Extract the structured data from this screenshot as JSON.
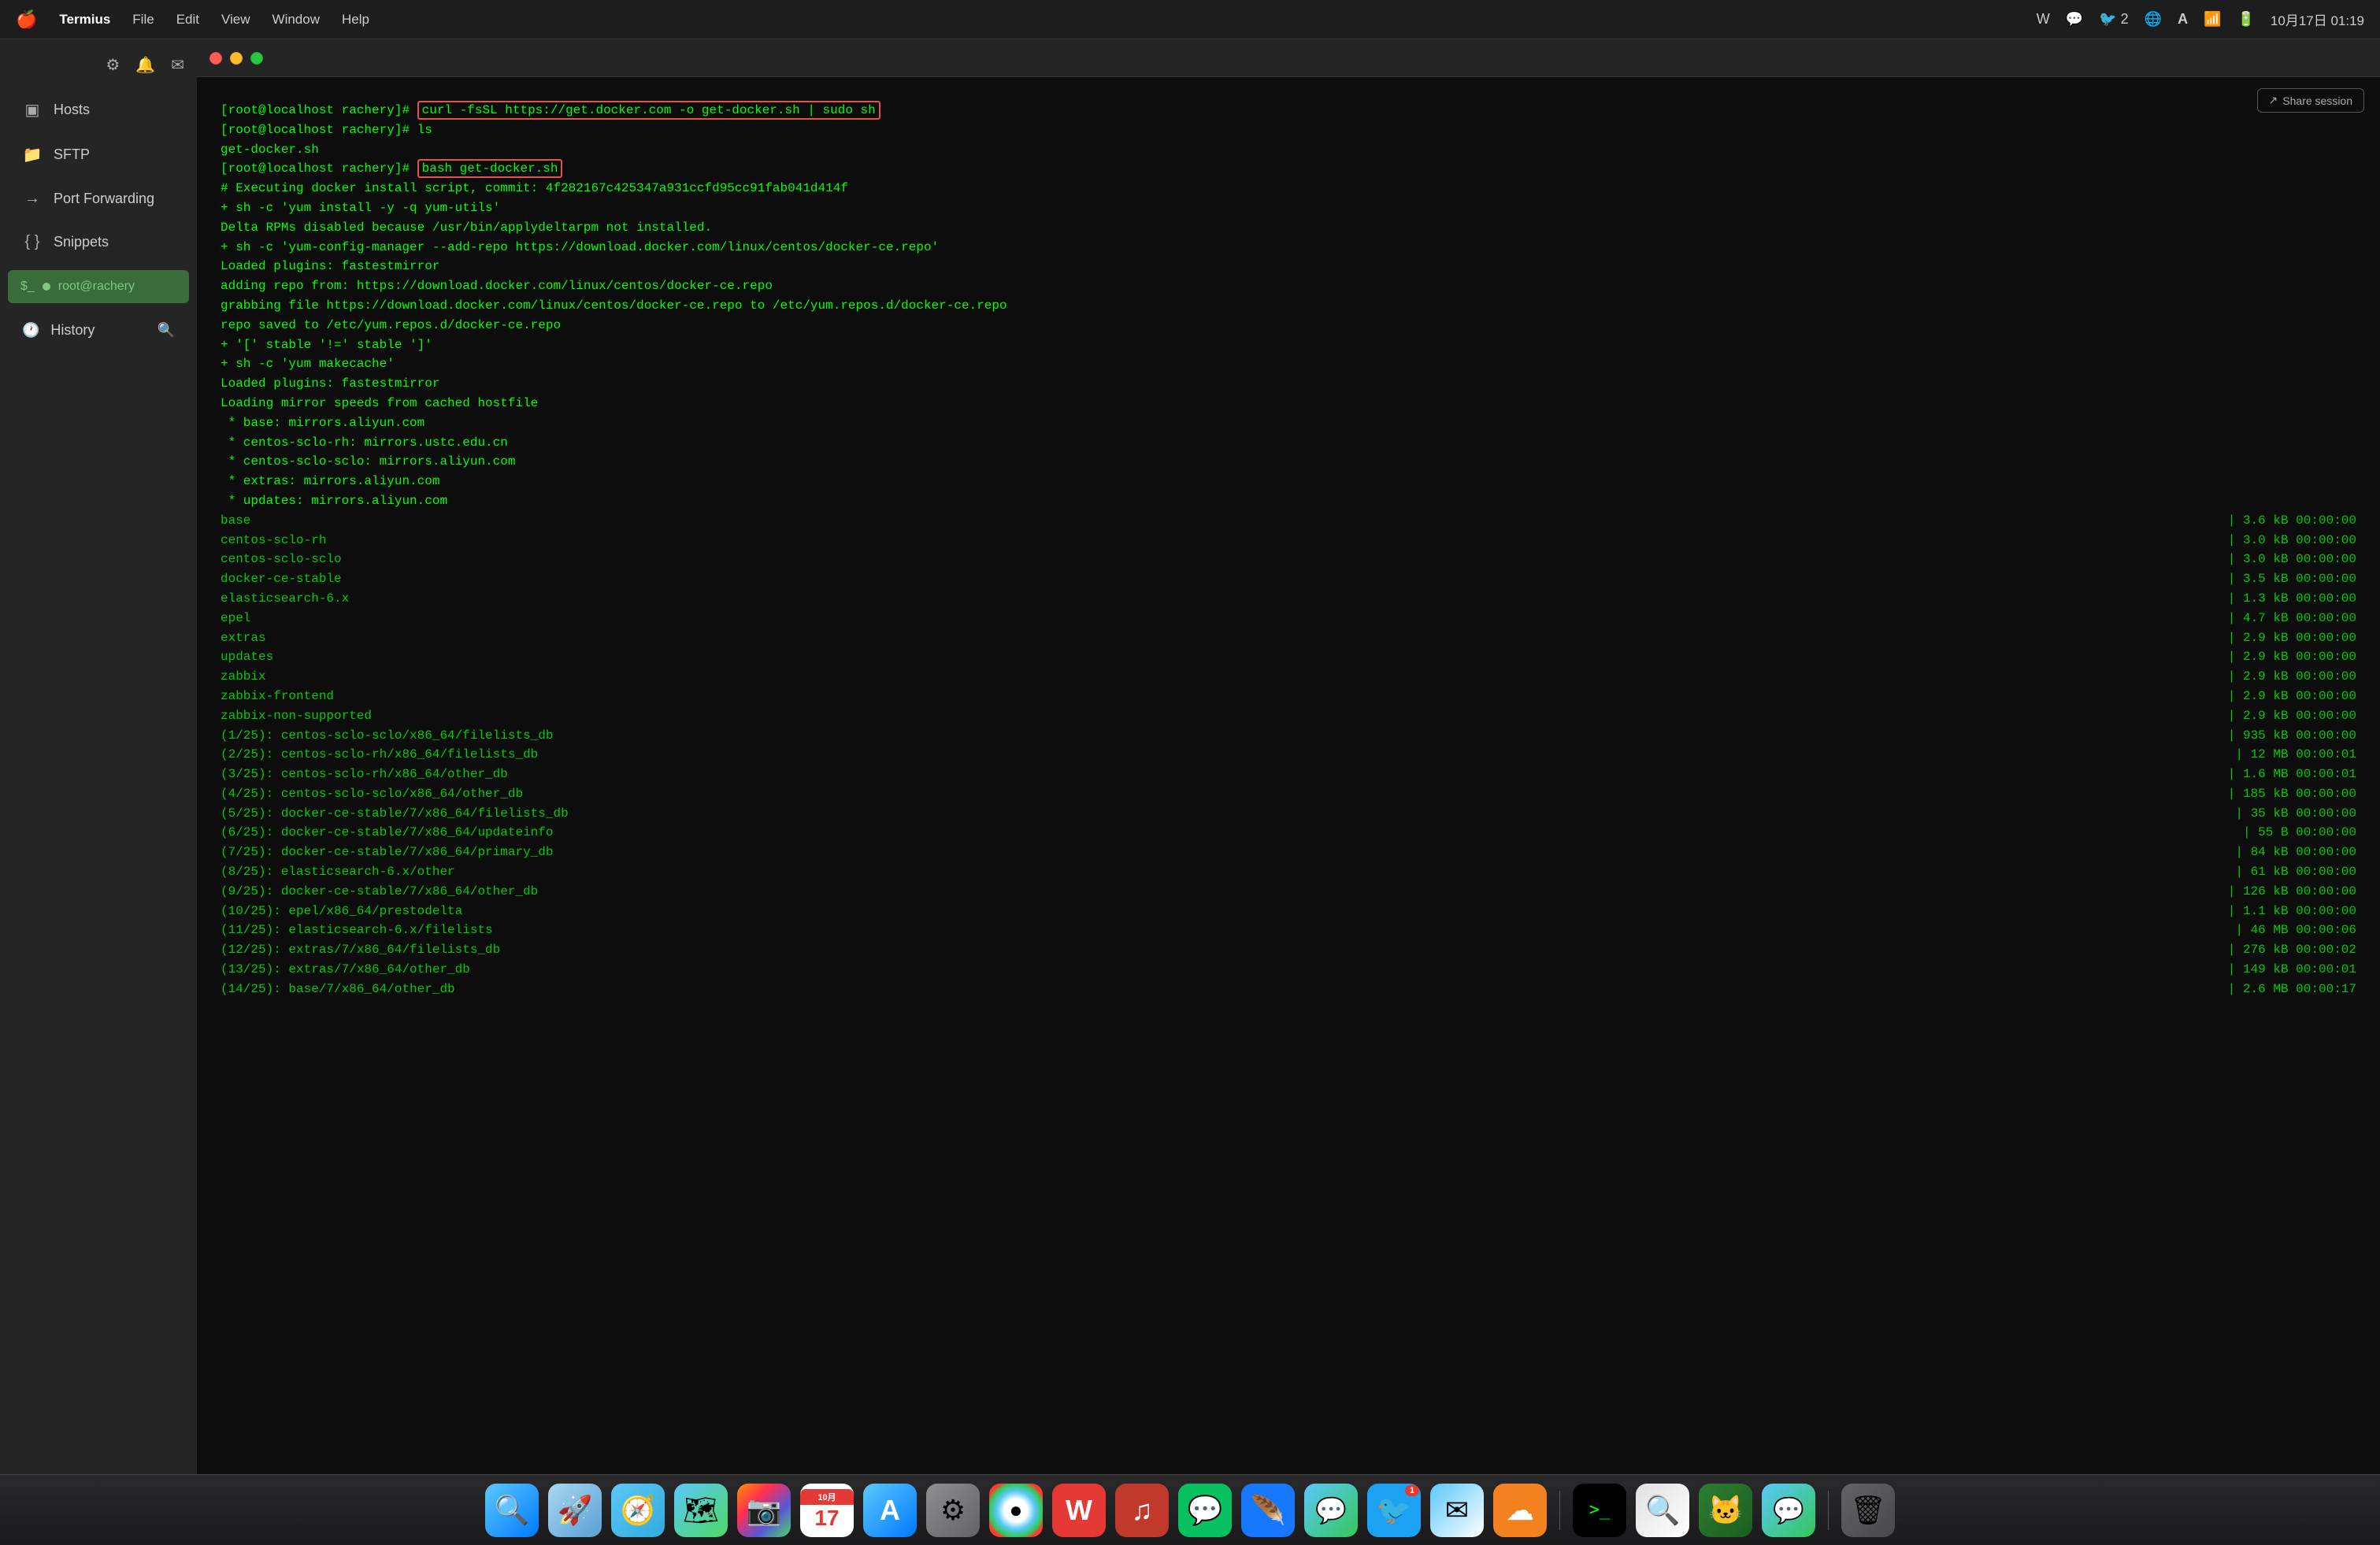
{
  "menubar": {
    "apple": "🍎",
    "app": "Termius",
    "items": [
      "File",
      "Edit",
      "View",
      "Window",
      "Help"
    ]
  },
  "menubar_right": {
    "items": [
      "W",
      "💬",
      "🐦",
      "🌐",
      "A",
      "📶",
      "🔋",
      "10月17日",
      "01:19"
    ]
  },
  "sidebar": {
    "settings_icon": "⚙",
    "bell_icon": "🔔",
    "mail_icon": "✉",
    "hosts_label": "Hosts",
    "sftp_label": "SFTP",
    "port_forwarding_label": "Port Forwarding",
    "snippets_label": "Snippets",
    "active_session_label": "root@rachery",
    "history_label": "History"
  },
  "terminal": {
    "share_session_label": "Share session",
    "lines": [
      {
        "type": "prompt",
        "text": "[root@localhost rachery]#",
        "cmd": "curl -fsSL https://get.docker.com -o get-docker.sh | sudo sh",
        "highlight": true
      },
      {
        "type": "prompt",
        "text": "[root@localhost rachery]#",
        "cmd": "ls",
        "highlight": false
      },
      {
        "type": "normal",
        "text": "get-docker.sh"
      },
      {
        "type": "prompt",
        "text": "[root@localhost rachery]#",
        "cmd": "bash get-docker.sh",
        "highlight": true
      },
      {
        "type": "normal",
        "text": "# Executing docker install script, commit: 4f282167c425347a931ccfd95cc91fab041d414f"
      },
      {
        "type": "normal",
        "text": "+ sh -c 'yum install -y -q yum-utils'"
      },
      {
        "type": "normal",
        "text": "Delta RPMs disabled because /usr/bin/applydeltarpm not installed."
      },
      {
        "type": "normal",
        "text": "+ sh -c 'yum-config-manager --add-repo https://download.docker.com/linux/centos/docker-ce.repo'"
      },
      {
        "type": "normal",
        "text": "Loaded plugins: fastestmirror"
      },
      {
        "type": "normal",
        "text": "adding repo from: https://download.docker.com/linux/centos/docker-ce.repo"
      },
      {
        "type": "normal",
        "text": "grabbing file https://download.docker.com/linux/centos/docker-ce.repo to /etc/yum.repos.d/docker-ce.repo"
      },
      {
        "type": "normal",
        "text": "repo saved to /etc/yum.repos.d/docker-ce.repo"
      },
      {
        "type": "normal",
        "text": "+ '[' stable '!=' stable ']'"
      },
      {
        "type": "normal",
        "text": "+ sh -c 'yum makecache'"
      },
      {
        "type": "normal",
        "text": "Loaded plugins: fastestmirror"
      },
      {
        "type": "normal",
        "text": "Loading mirror speeds from cached hostfile"
      },
      {
        "type": "normal",
        "text": " * base: mirrors.aliyun.com"
      },
      {
        "type": "normal",
        "text": " * centos-sclo-rh: mirrors.ustc.edu.cn"
      },
      {
        "type": "normal",
        "text": " * centos-sclo-sclo: mirrors.aliyun.com"
      },
      {
        "type": "normal",
        "text": " * extras: mirrors.aliyun.com"
      },
      {
        "type": "normal",
        "text": " * updates: mirrors.aliyun.com"
      },
      {
        "type": "table",
        "left": "base",
        "right": "| 3.6 kB   00:00:00"
      },
      {
        "type": "table",
        "left": "centos-sclo-rh",
        "right": "| 3.0 kB   00:00:00"
      },
      {
        "type": "table",
        "left": "centos-sclo-sclo",
        "right": "| 3.0 kB   00:00:00"
      },
      {
        "type": "table",
        "left": "docker-ce-stable",
        "right": "| 3.5 kB   00:00:00"
      },
      {
        "type": "table",
        "left": "elasticsearch-6.x",
        "right": "| 1.3 kB   00:00:00"
      },
      {
        "type": "table",
        "left": "epel",
        "right": "| 4.7 kB   00:00:00"
      },
      {
        "type": "table",
        "left": "extras",
        "right": "| 2.9 kB   00:00:00"
      },
      {
        "type": "table",
        "left": "updates",
        "right": "| 2.9 kB   00:00:00"
      },
      {
        "type": "table",
        "left": "zabbix",
        "right": "| 2.9 kB   00:00:00"
      },
      {
        "type": "table",
        "left": "zabbix-frontend",
        "right": "| 2.9 kB   00:00:00"
      },
      {
        "type": "table",
        "left": "zabbix-non-supported",
        "right": "| 2.9 kB   00:00:00"
      },
      {
        "type": "table",
        "left": "(1/25): centos-sclo-sclo/x86_64/filelists_db",
        "right": "| 935 kB   00:00:00"
      },
      {
        "type": "table",
        "left": "(2/25): centos-sclo-rh/x86_64/filelists_db",
        "right": "|  12 MB   00:00:01"
      },
      {
        "type": "table",
        "left": "(3/25): centos-sclo-rh/x86_64/other_db",
        "right": "| 1.6 MB   00:00:01"
      },
      {
        "type": "table",
        "left": "(4/25): centos-sclo-sclo/x86_64/other_db",
        "right": "| 185 kB   00:00:00"
      },
      {
        "type": "table",
        "left": "(5/25): docker-ce-stable/7/x86_64/filelists_db",
        "right": "|  35 kB   00:00:00"
      },
      {
        "type": "table",
        "left": "(6/25): docker-ce-stable/7/x86_64/updateinfo",
        "right": "|   55 B   00:00:00"
      },
      {
        "type": "table",
        "left": "(7/25): docker-ce-stable/7/x86_64/primary_db",
        "right": "|  84 kB   00:00:00"
      },
      {
        "type": "table",
        "left": "(8/25): elasticsearch-6.x/other",
        "right": "|  61 kB   00:00:00"
      },
      {
        "type": "table",
        "left": "(9/25): docker-ce-stable/7/x86_64/other_db",
        "right": "| 126 kB   00:00:00"
      },
      {
        "type": "table",
        "left": "(10/25): epel/x86_64/prestodelta",
        "right": "| 1.1 kB   00:00:00"
      },
      {
        "type": "table",
        "left": "(11/25): elasticsearch-6.x/filelists",
        "right": "|  46 MB   00:00:06"
      },
      {
        "type": "table",
        "left": "(12/25): extras/7/x86_64/filelists_db",
        "right": "| 276 kB   00:00:02"
      },
      {
        "type": "table",
        "left": "(13/25): extras/7/x86_64/other_db",
        "right": "| 149 kB   00:00:01"
      },
      {
        "type": "table",
        "left": "(14/25): base/7/x86_64/other_db",
        "right": "| 2.6 MB   00:00:17"
      }
    ]
  },
  "dock": {
    "items": [
      {
        "name": "Finder",
        "icon": "🔍",
        "class": "finder"
      },
      {
        "name": "Launchpad",
        "icon": "🚀",
        "class": "launchpad"
      },
      {
        "name": "Safari",
        "icon": "🧭",
        "class": "safari"
      },
      {
        "name": "Maps",
        "icon": "🗺",
        "class": "maps"
      },
      {
        "name": "Photos",
        "icon": "📷",
        "class": "photos"
      },
      {
        "name": "Calendar",
        "icon": "📅",
        "class": "calendar",
        "date": "17"
      },
      {
        "name": "App Store",
        "icon": "A",
        "class": "appstore"
      },
      {
        "name": "System Settings",
        "icon": "⚙",
        "class": "settings"
      },
      {
        "name": "Chrome",
        "icon": "●",
        "class": "chrome"
      },
      {
        "name": "WPS",
        "icon": "W",
        "class": "wps"
      },
      {
        "name": "Music",
        "icon": "♪",
        "class": "music-red"
      },
      {
        "name": "WeChat",
        "icon": "💬",
        "class": "wechat"
      },
      {
        "name": "Lark",
        "icon": "🪶",
        "class": "lark"
      },
      {
        "name": "Messages",
        "icon": "💬",
        "class": "messages"
      },
      {
        "name": "Twitter",
        "icon": "🐦",
        "class": "unknown1",
        "badge": "1"
      },
      {
        "name": "Mail",
        "icon": "✉",
        "class": "mail"
      },
      {
        "name": "Cloudflare",
        "icon": "☁",
        "class": "cloudflare"
      },
      {
        "name": "Terminal",
        "icon": ">_",
        "class": "terminal"
      },
      {
        "name": "Spotlight",
        "icon": "🔍",
        "class": "spotlight"
      },
      {
        "name": "Catapult",
        "icon": "🐱",
        "class": "catapult"
      },
      {
        "name": "iMessage",
        "icon": "💬",
        "class": "imessage"
      },
      {
        "name": "Trash",
        "icon": "🗑",
        "class": "trash"
      }
    ]
  }
}
